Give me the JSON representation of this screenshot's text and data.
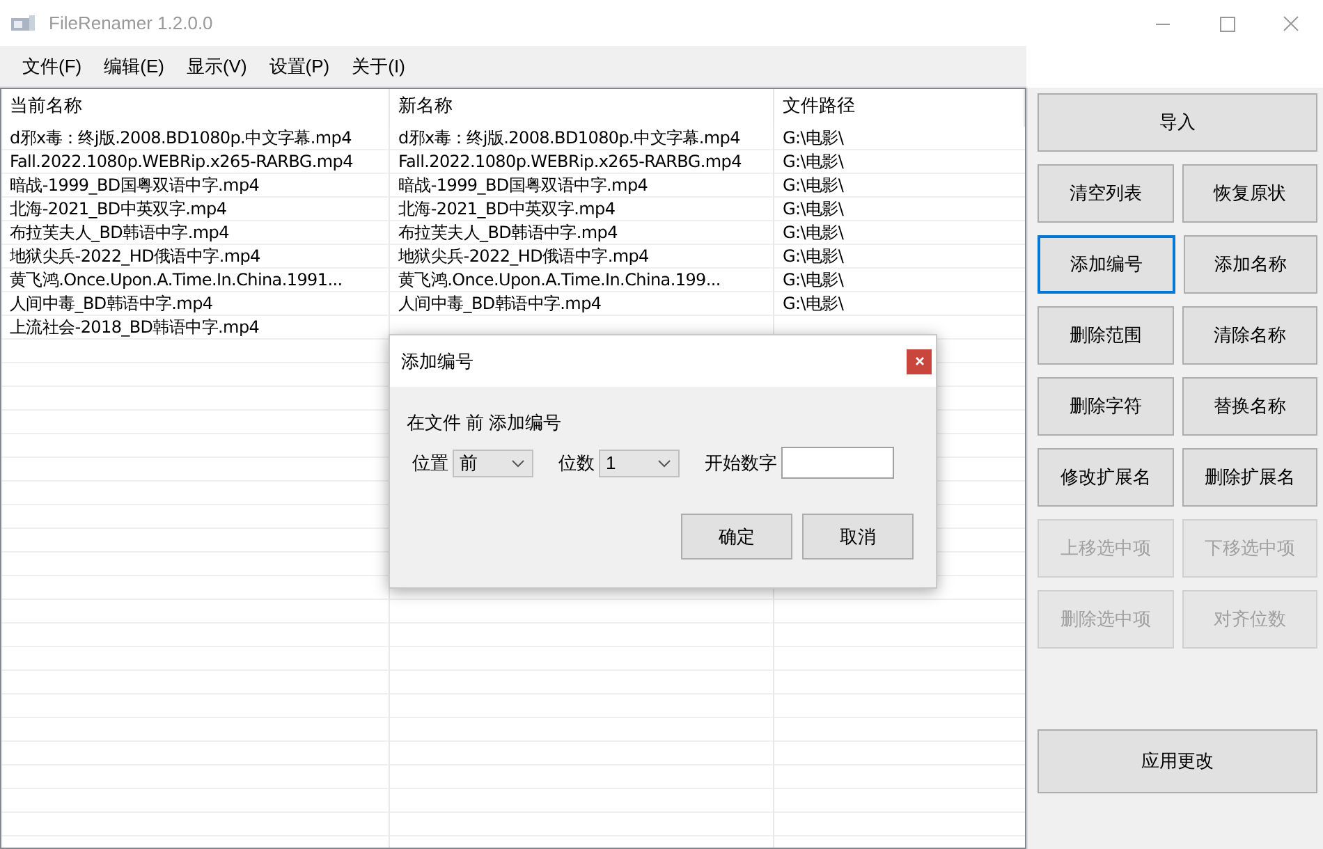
{
  "window": {
    "title": "FileRenamer 1.2.0.0"
  },
  "menu": [
    "文件(F)",
    "编辑(E)",
    "显示(V)",
    "设置(P)",
    "关于(I)"
  ],
  "table": {
    "columns": [
      "当前名称",
      "新名称",
      "文件路径"
    ],
    "rows": [
      {
        "current": "d邪x毒：终j版.2008.BD1080p.中文字幕.mp4",
        "new": "d邪x毒：终j版.2008.BD1080p.中文字幕.mp4",
        "path": "G:\\电影\\"
      },
      {
        "current": "Fall.2022.1080p.WEBRip.x265-RARBG.mp4",
        "new": "Fall.2022.1080p.WEBRip.x265-RARBG.mp4",
        "path": "G:\\电影\\"
      },
      {
        "current": "暗战-1999_BD国粤双语中字.mp4",
        "new": "暗战-1999_BD国粤双语中字.mp4",
        "path": "G:\\电影\\"
      },
      {
        "current": "北海-2021_BD中英双字.mp4",
        "new": "北海-2021_BD中英双字.mp4",
        "path": "G:\\电影\\"
      },
      {
        "current": "布拉芙夫人_BD韩语中字.mp4",
        "new": "布拉芙夫人_BD韩语中字.mp4",
        "path": "G:\\电影\\"
      },
      {
        "current": "地狱尖兵-2022_HD俄语中字.mp4",
        "new": "地狱尖兵-2022_HD俄语中字.mp4",
        "path": "G:\\电影\\"
      },
      {
        "current": "黄飞鸿.Once.Upon.A.Time.In.China.1991...",
        "new": "黄飞鸿.Once.Upon.A.Time.In.China.199...",
        "path": "G:\\电影\\"
      },
      {
        "current": "人间中毒_BD韩语中字.mp4",
        "new": "人间中毒_BD韩语中字.mp4",
        "path": "G:\\电影\\"
      },
      {
        "current": "上流社会-2018_BD韩语中字.mp4"
      }
    ]
  },
  "button_rows": [
    [
      {
        "label": "导入",
        "disabled": false,
        "focused": false
      }
    ],
    [
      {
        "label": "清空列表",
        "disabled": false,
        "focused": false
      },
      {
        "label": "恢复原状",
        "disabled": false,
        "focused": false
      }
    ],
    [
      {
        "label": "添加编号",
        "disabled": false,
        "focused": true
      },
      {
        "label": "添加名称",
        "disabled": false,
        "focused": false
      }
    ],
    [
      {
        "label": "删除范围",
        "disabled": false,
        "focused": false
      },
      {
        "label": "清除名称",
        "disabled": false,
        "focused": false
      }
    ],
    [
      {
        "label": "删除字符",
        "disabled": false,
        "focused": false
      },
      {
        "label": "替换名称",
        "disabled": false,
        "focused": false
      }
    ],
    [
      {
        "label": "修改扩展名",
        "disabled": false,
        "focused": false
      },
      {
        "label": "删除扩展名",
        "disabled": false,
        "focused": false
      }
    ],
    [
      {
        "label": "上移选中项",
        "disabled": true,
        "focused": false
      },
      {
        "label": "下移选中项",
        "disabled": true,
        "focused": false
      }
    ],
    [
      {
        "label": "删除选中项",
        "disabled": true,
        "focused": false
      },
      {
        "label": "对齐位数",
        "disabled": true,
        "focused": false
      }
    ]
  ],
  "apply_button": {
    "label": "应用更改",
    "disabled": false
  },
  "dialog": {
    "title": "添加编号",
    "message": "在文件 前 添加编号",
    "fields": [
      {
        "kind": "dropdown",
        "label": "位置",
        "value": "前"
      },
      {
        "kind": "dropdown",
        "label": "位数",
        "value": "1"
      },
      {
        "kind": "text",
        "label": "开始数字"
      }
    ],
    "buttons": [
      "确定",
      "取消"
    ]
  }
}
